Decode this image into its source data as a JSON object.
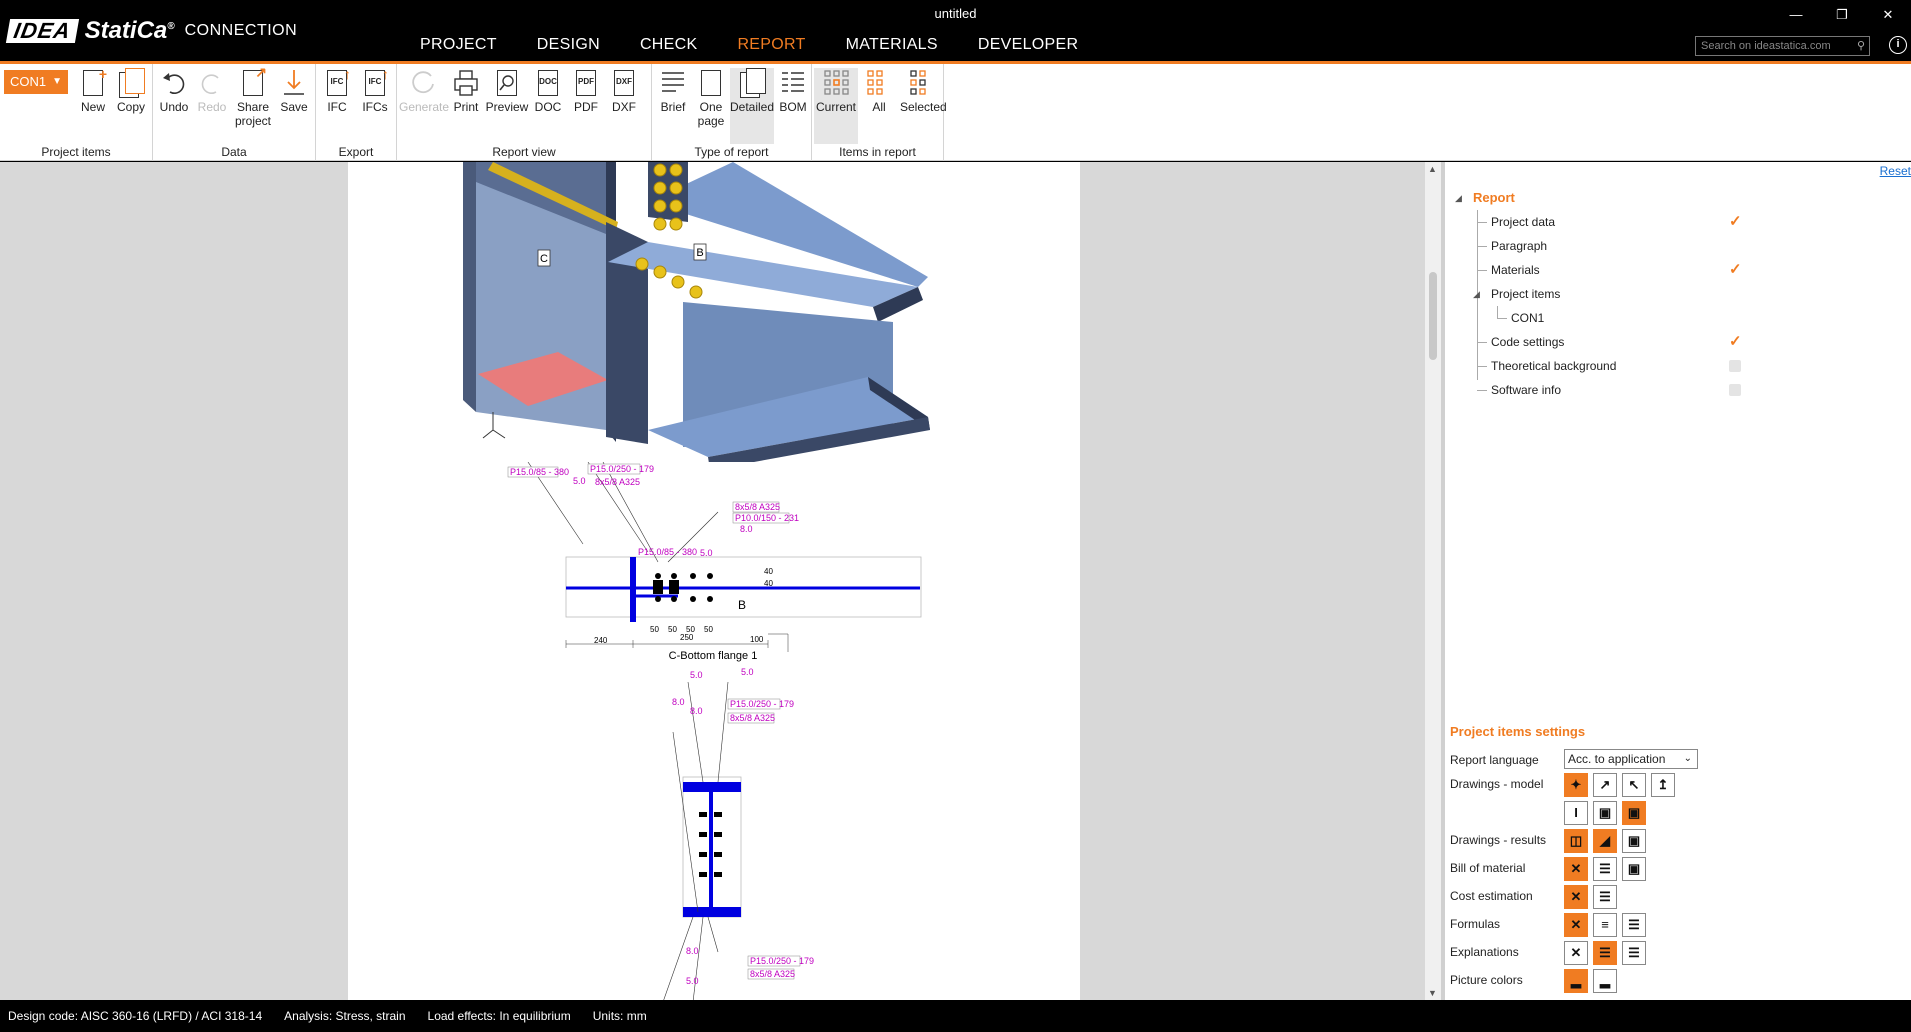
{
  "window": {
    "title": "untitled"
  },
  "app": {
    "brand_idea": "IDEA",
    "brand_statica": "StatiCa",
    "brand_reg": "®",
    "brand_product": "CONNECTION"
  },
  "menu": [
    "PROJECT",
    "DESIGN",
    "CHECK",
    "REPORT",
    "MATERIALS",
    "DEVELOPER"
  ],
  "menu_active": "REPORT",
  "search": {
    "placeholder": "Search on ideastatica.com"
  },
  "ribbon": {
    "project_items": {
      "selected": "CON1",
      "new": "New",
      "copy": "Copy",
      "title": "Project items"
    },
    "data": {
      "undo": "Undo",
      "redo": "Redo",
      "share": "Share project",
      "save": "Save",
      "title": "Data"
    },
    "export": {
      "ifc": "IFC",
      "ifcs": "IFCs",
      "title": "Export"
    },
    "report_view": {
      "generate": "Generate",
      "print": "Print",
      "preview": "Preview",
      "doc": "DOC",
      "pdf": "PDF",
      "dxf": "DXF",
      "title": "Report view"
    },
    "type_of_report": {
      "brief": "Brief",
      "one_page": "One page",
      "detailed": "Detailed",
      "bom": "BOM",
      "title": "Type of report"
    },
    "items_in_report": {
      "current": "Current",
      "all": "All",
      "selected": "Selected",
      "title": "Items in report"
    }
  },
  "drawing": {
    "label_c": "C",
    "label_b": "B",
    "plan_label_b": "B",
    "caption": "C-Bottom flange 1",
    "weld_5": "5.0",
    "weld_8": "8.0",
    "plate1": "P15.0/85 - 380",
    "plate2": "P15.0/250 - 179",
    "bolts": "8x5/8 A325",
    "plate3": "P10.0/150 - 231",
    "dims": [
      "240",
      "50",
      "50",
      "50",
      "50",
      "250",
      "100",
      "40",
      "40"
    ]
  },
  "report_tree": {
    "reset": "Reset",
    "root": "Report",
    "items": [
      {
        "label": "Project data",
        "checked": true
      },
      {
        "label": "Paragraph",
        "checked": null
      },
      {
        "label": "Materials",
        "checked": true
      },
      {
        "label": "Project items",
        "checked": null
      },
      {
        "label": "CON1",
        "checked": null
      },
      {
        "label": "Code settings",
        "checked": true
      },
      {
        "label": "Theoretical background",
        "checked": false
      },
      {
        "label": "Software info",
        "checked": false
      }
    ]
  },
  "settings": {
    "title": "Project items settings",
    "report_language": "Report language",
    "language_value": "Acc. to application",
    "drawings_model": "Drawings - model",
    "drawings_results": "Drawings - results",
    "bill_of_material": "Bill of material",
    "cost_estimation": "Cost estimation",
    "formulas": "Formulas",
    "explanations": "Explanations",
    "picture_colors": "Picture colors"
  },
  "status": {
    "design_code": "Design code: AISC 360-16 (LRFD) / ACI 318-14",
    "analysis": "Analysis: Stress, strain",
    "load_effects": "Load effects: In equilibrium",
    "units": "Units: mm"
  },
  "colors": {
    "accent": "#f07c22",
    "beam": "#7c9bcd",
    "bolt": "#e8c21a",
    "plate": "#e87c7c",
    "weld_blue": "#0000e0"
  }
}
